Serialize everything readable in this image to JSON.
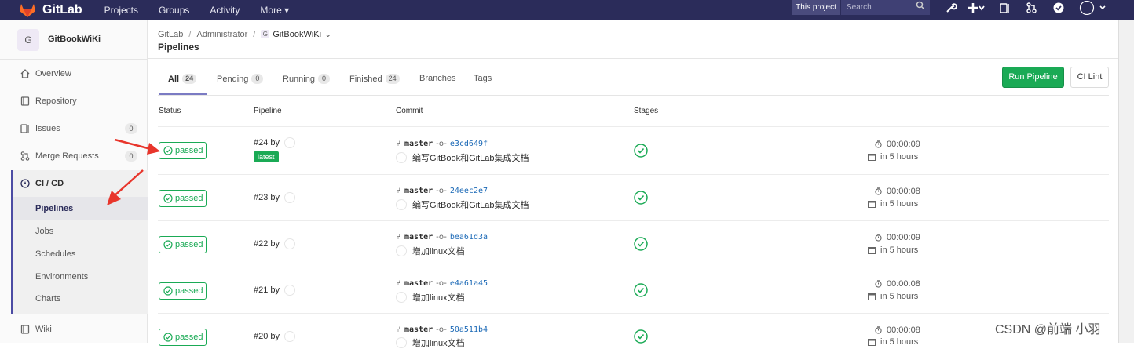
{
  "navbar": {
    "brand": "GitLab",
    "links": [
      "Projects",
      "Groups",
      "Activity",
      "More"
    ],
    "scope": "This project",
    "search_placeholder": "Search"
  },
  "sidebar": {
    "avatar_letter": "G",
    "project_name": "GitBookWiKi",
    "items": [
      {
        "label": "Overview"
      },
      {
        "label": "Repository"
      },
      {
        "label": "Issues",
        "badge": "0"
      },
      {
        "label": "Merge Requests",
        "badge": "0"
      },
      {
        "label": "CI / CD"
      }
    ],
    "cicd_subitems": [
      "Pipelines",
      "Jobs",
      "Schedules",
      "Environments",
      "Charts"
    ],
    "wiki": "Wiki"
  },
  "breadcrumb": {
    "items": [
      "GitLab",
      "Administrator",
      "GitBookWiKi"
    ]
  },
  "page_title": "Pipelines",
  "tabs": [
    {
      "label": "All",
      "count": "24"
    },
    {
      "label": "Pending",
      "count": "0"
    },
    {
      "label": "Running",
      "count": "0"
    },
    {
      "label": "Finished",
      "count": "24"
    },
    {
      "label": "Branches"
    },
    {
      "label": "Tags"
    }
  ],
  "buttons": {
    "run_pipeline": "Run Pipeline",
    "ci_lint": "CI Lint"
  },
  "table": {
    "headers": [
      "Status",
      "Pipeline",
      "Commit",
      "Stages"
    ],
    "rows": [
      {
        "status": "passed",
        "pipeline": "#24 by",
        "latest": "latest",
        "branch": "master",
        "sha": "e3cd649f",
        "message": "编写GitBook和GitLab集成文档",
        "duration": "00:00:09",
        "finished": "in 5 hours"
      },
      {
        "status": "passed",
        "pipeline": "#23 by",
        "branch": "master",
        "sha": "24eec2e7",
        "message": "编写GitBook和GitLab集成文档",
        "duration": "00:00:08",
        "finished": "in 5 hours"
      },
      {
        "status": "passed",
        "pipeline": "#22 by",
        "branch": "master",
        "sha": "bea61d3a",
        "message": "增加linux文档",
        "duration": "00:00:09",
        "finished": "in 5 hours"
      },
      {
        "status": "passed",
        "pipeline": "#21 by",
        "branch": "master",
        "sha": "e4a61a45",
        "message": "增加linux文档",
        "duration": "00:00:08",
        "finished": "in 5 hours"
      },
      {
        "status": "passed",
        "pipeline": "#20 by",
        "branch": "master",
        "sha": "50a511b4",
        "message": "增加linux文档",
        "duration": "00:00:08",
        "finished": "in 5 hours"
      }
    ]
  },
  "watermark": "CSDN @前端 小羽",
  "colors": {
    "navbar": "#2b2c5a",
    "success": "#1aaa55",
    "link": "#1b69b6",
    "annotation": "#e8352b"
  }
}
